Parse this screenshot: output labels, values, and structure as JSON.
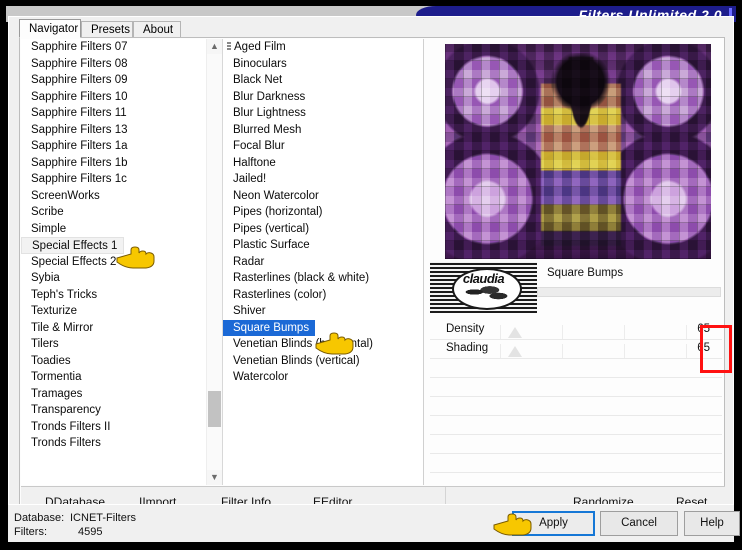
{
  "window": {
    "title": "Filters Unlimited 2.0"
  },
  "tabs": [
    {
      "label": "Navigator",
      "active": true
    },
    {
      "label": "Presets",
      "active": false
    },
    {
      "label": "About",
      "active": false
    }
  ],
  "categories": {
    "items": [
      "Sapphire Filters 07",
      "Sapphire Filters 08",
      "Sapphire Filters 09",
      "Sapphire Filters 10",
      "Sapphire Filters 11",
      "Sapphire Filters 13",
      "Sapphire Filters 1a",
      "Sapphire Filters 1b",
      "Sapphire Filters 1c",
      "ScreenWorks",
      "Scribe",
      "Simple",
      "Special Effects 1",
      "Special Effects 2",
      "Sybia",
      "Teph's Tricks",
      "Texturize",
      "Tile & Mirror",
      "Tilers",
      "Toadies",
      "Tormentia",
      "Tramages",
      "Transparency",
      "Tronds Filters II",
      "Tronds Filters"
    ],
    "selected": "Special Effects 1",
    "scroll_up_glyph": "⌃",
    "scroll_down_glyph": "⌄"
  },
  "filters": {
    "items": [
      "Aged Film",
      "Binoculars",
      "Black Net",
      "Blur Darkness",
      "Blur Lightness",
      "Blurred Mesh",
      "Focal Blur",
      "Halftone",
      "Jailed!",
      "Neon Watercolor",
      "Pipes (horizontal)",
      "Pipes (vertical)",
      "Plastic Surface",
      "Radar",
      "Rasterlines (black & white)",
      "Rasterlines (color)",
      "Shiver",
      "Square Bumps",
      "Venetian Blinds (horizontal)",
      "Venetian Blinds (vertical)",
      "Watercolor"
    ],
    "selected": "Square Bumps"
  },
  "preview": {
    "watermark": "claudia"
  },
  "filter_panel": {
    "name": "Square Bumps",
    "parameters": [
      {
        "label": "Density",
        "value": "65"
      },
      {
        "label": "Shading",
        "value": "65"
      }
    ]
  },
  "commands": {
    "database": "Database",
    "import": "Import...",
    "filter_info": "Filter Info...",
    "editor": "Editor...",
    "randomize": "Randomize",
    "reset": "Reset"
  },
  "status": {
    "database_label": "Database:",
    "database_value": "ICNET-Filters",
    "filters_label": "Filters:",
    "filters_value": "4595"
  },
  "buttons": {
    "apply": "Apply",
    "cancel": "Cancel",
    "help": "Help"
  },
  "colors": {
    "title_banner": "#1d1d8c",
    "selection_blue": "#1b69d6",
    "focus_blue": "#1577d6",
    "annotation_red": "#ff1111",
    "cursor_yellow": "#f5c518"
  }
}
